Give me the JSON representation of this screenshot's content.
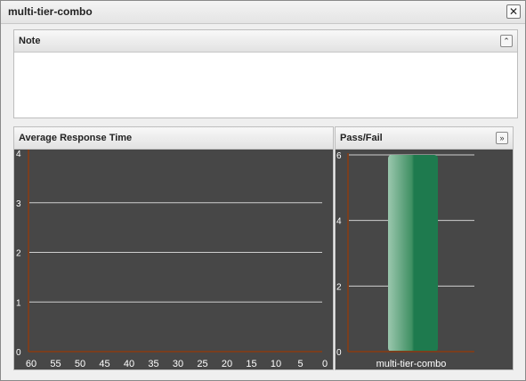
{
  "window": {
    "title": "multi-tier-combo",
    "close_glyph": "✕"
  },
  "note_panel": {
    "title": "Note",
    "collapse_icon": "⌃",
    "body": ""
  },
  "art_panel": {
    "title": "Average Response Time"
  },
  "pf_panel": {
    "title": "Pass/Fail",
    "expand_icon": "»"
  },
  "colors": {
    "chart_bg": "#474747",
    "axis": "#7a3e1e",
    "grid": "#cfcfcf",
    "tick_text": "#ffffff",
    "bar": "#1e7a4e",
    "bar_highlight": "#9bc7ae"
  },
  "chart_data": [
    {
      "type": "line",
      "title": "Average Response Time",
      "x": [
        60,
        55,
        50,
        45,
        40,
        35,
        30,
        25,
        20,
        15,
        10,
        5,
        0
      ],
      "xlim": [
        60,
        0
      ],
      "ylim": [
        0,
        4
      ],
      "yticks": [
        0,
        1,
        2,
        3,
        4
      ],
      "series": [],
      "grid": true
    },
    {
      "type": "bar",
      "title": "Pass/Fail",
      "categories": [
        "multi-tier-combo"
      ],
      "values": [
        6
      ],
      "ylim": [
        0,
        6
      ],
      "yticks": [
        0,
        2,
        4,
        6
      ],
      "grid": true
    }
  ]
}
